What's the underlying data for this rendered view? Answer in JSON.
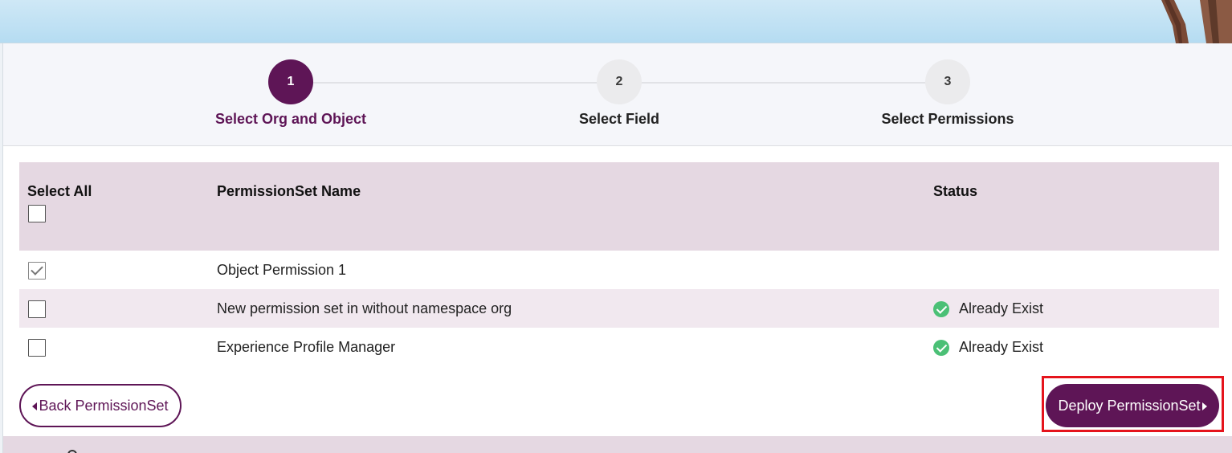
{
  "colors": {
    "brand": "#5e1556",
    "header_row": "#e5d8e2",
    "alt_row": "#f1e8ef",
    "success": "#4bc076",
    "highlight": "#e5141c"
  },
  "stepper": {
    "steps": [
      {
        "number": "1",
        "label": "Select Org and Object",
        "active": true
      },
      {
        "number": "2",
        "label": "Select Field",
        "active": false
      },
      {
        "number": "3",
        "label": "Select Permissions",
        "active": false
      }
    ]
  },
  "table": {
    "headers": {
      "select_all": "Select All",
      "name": "PermissionSet Name",
      "status": "Status"
    },
    "rows": [
      {
        "checked": true,
        "name": "Object Permission 1",
        "status": "",
        "status_icon": ""
      },
      {
        "checked": false,
        "name": "New permission set in without namespace org",
        "status": "Already Exist",
        "status_icon": "check-circle-icon"
      },
      {
        "checked": false,
        "name": "Experience Profile Manager",
        "status": "Already Exist",
        "status_icon": "check-circle-icon"
      }
    ]
  },
  "actions": {
    "back_label": "Back PermissionSet",
    "deploy_label": "Deploy PermissionSet"
  }
}
